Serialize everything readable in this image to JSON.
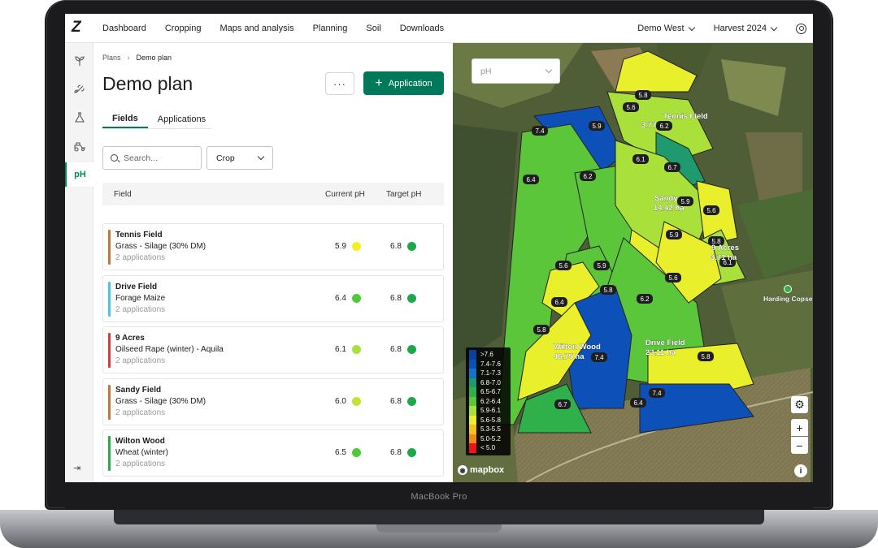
{
  "nav": {
    "items": [
      "Dashboard",
      "Cropping",
      "Maps and analysis",
      "Planning",
      "Soil",
      "Downloads"
    ],
    "farm": "Demo West",
    "harvest": "Harvest 2024",
    "logo": "Z"
  },
  "sidebar": {
    "active_label": "pH"
  },
  "breadcrumb": {
    "root": "Plans",
    "current": "Demo plan"
  },
  "page": {
    "title": "Demo plan",
    "more_label": "···",
    "application_button": "Application"
  },
  "tabs": [
    "Fields",
    "Applications"
  ],
  "filters": {
    "search_placeholder": "Search...",
    "crop_label": "Crop"
  },
  "table": {
    "headers": {
      "field": "Field",
      "current": "Current pH",
      "target": "Target pH"
    },
    "rows": [
      {
        "name": "Tennis Field",
        "crop": "Grass - Silage (30% DM)",
        "apps": "2 applications",
        "current": "5.9",
        "target": "6.8",
        "bar_color": "#c0763c",
        "current_color": "#f5ee1e",
        "target_color": "#1fa84a"
      },
      {
        "name": "Drive Field",
        "crop": "Forage Maize",
        "apps": "2 applications",
        "current": "6.4",
        "target": "6.8",
        "bar_color": "#4ec3e6",
        "current_color": "#4fc83a",
        "target_color": "#1fa84a"
      },
      {
        "name": "9 Acres",
        "crop": "Oilseed Rape (winter) - Aquila",
        "apps": "2 applications",
        "current": "6.1",
        "target": "6.8",
        "bar_color": "#d63a3a",
        "current_color": "#a8e03a",
        "target_color": "#1fa84a"
      },
      {
        "name": "Sandy Field",
        "crop": "Grass - Silage (30% DM)",
        "apps": "2 applications",
        "current": "6.0",
        "target": "6.8",
        "bar_color": "#c0763c",
        "current_color": "#c5e23a",
        "target_color": "#1fa84a"
      },
      {
        "name": "Wilton Wood",
        "crop": "Wheat (winter)",
        "apps": "2 applications",
        "current": "6.5",
        "target": "6.8",
        "bar_color": "#2aa84a",
        "current_color": "#4fc83a",
        "target_color": "#1fa84a"
      }
    ]
  },
  "map": {
    "layer_select": "pH",
    "legend": [
      {
        "label": ">7.6",
        "color": "#0d3f9e"
      },
      {
        "label": "7.4-7.6",
        "color": "#0d51b8"
      },
      {
        "label": "7.1-7.3",
        "color": "#1870c9"
      },
      {
        "label": "6.8-7.0",
        "color": "#1f9a6e"
      },
      {
        "label": "6.5-6.7",
        "color": "#2fb04a"
      },
      {
        "label": "6.2-6.4",
        "color": "#5bc63a"
      },
      {
        "label": "5.9-6.1",
        "color": "#a9e03a"
      },
      {
        "label": "5.6-5.8",
        "color": "#e9ef2a"
      },
      {
        "label": "5.3-5.5",
        "color": "#f7c21c"
      },
      {
        "label": "5.0-5.2",
        "color": "#f38a14"
      },
      {
        "label": "< 5.0",
        "color": "#e8161a"
      }
    ],
    "field_labels": [
      {
        "name": "Tennis Field",
        "area": "3.77"
      },
      {
        "name": "Sandy",
        "area": "14.42 ha"
      },
      {
        "name": "Wilton Wood",
        "area": "46.75 ha"
      },
      {
        "name": "Drive Field",
        "area": "23.11 ha"
      },
      {
        "name": "9 Acres",
        "area": "3.71 ha"
      }
    ],
    "place_label": "Harding Copse",
    "attribution": "mapbox",
    "zoom_in": "+",
    "zoom_out": "−"
  },
  "device_label": "MacBook Pro"
}
